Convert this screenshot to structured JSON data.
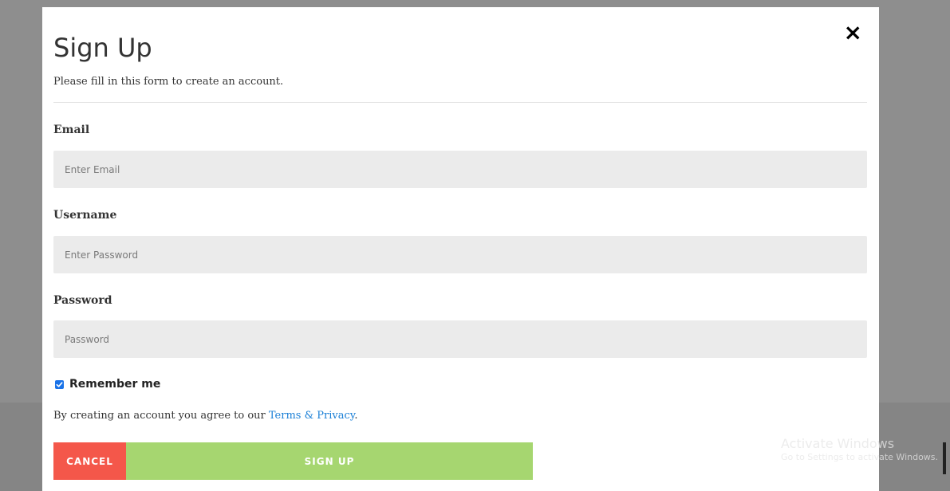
{
  "modal": {
    "close_symbol": "×",
    "title": "Sign Up",
    "subtitle": "Please fill in this form to create an account."
  },
  "form": {
    "email": {
      "label": "Email",
      "placeholder": "Enter Email",
      "value": ""
    },
    "username": {
      "label": "Username",
      "placeholder": "Enter Password",
      "value": ""
    },
    "password": {
      "label": "Password",
      "placeholder": "Password",
      "value": ""
    },
    "remember": {
      "label": "Remember me",
      "checked": true
    },
    "terms": {
      "prefix": "By creating an account you agree to our ",
      "link_text": "Terms & Privacy",
      "suffix": "."
    }
  },
  "buttons": {
    "cancel": "CANCEL",
    "signup": "SIGN UP"
  },
  "watermark": {
    "title": "Activate Windows",
    "subtitle": "Go to Settings to activate Windows."
  },
  "colors": {
    "cancel": "#f4574a",
    "signup": "#a6d670",
    "link": "#1a7fd6",
    "input_bg": "#ebebeb",
    "checkbox": "#1a73e8"
  },
  "icons": {
    "close": "close-icon",
    "check": "check-icon"
  }
}
